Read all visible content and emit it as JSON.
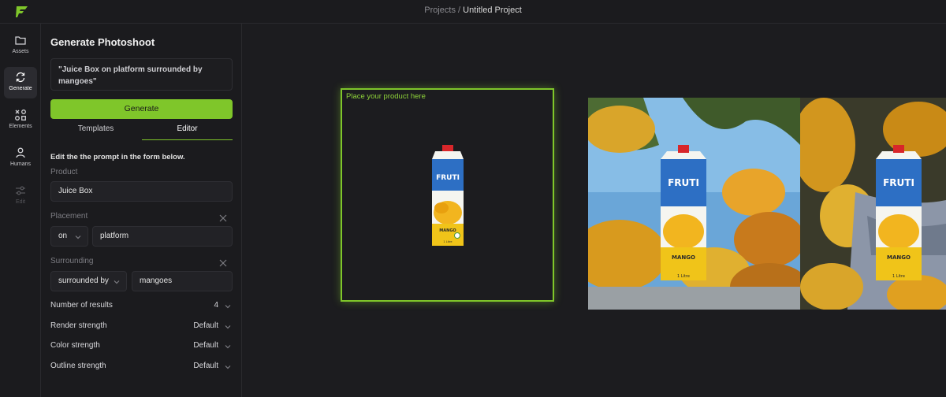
{
  "breadcrumb": {
    "parent": "Projects",
    "separator": " / ",
    "current": "Untitled Project"
  },
  "rail": {
    "items": [
      {
        "label": "Assets",
        "icon": "folder-icon"
      },
      {
        "label": "Generate",
        "icon": "refresh-icon"
      },
      {
        "label": "Elements",
        "icon": "shapes-icon"
      },
      {
        "label": "Humans",
        "icon": "person-icon"
      },
      {
        "label": "Edit",
        "icon": "sliders-icon"
      }
    ]
  },
  "panel": {
    "title": "Generate Photoshoot",
    "prompt": "\"Juice Box on platform surrounded by mangoes\"",
    "generate_label": "Generate",
    "tabs": [
      "Templates",
      "Editor"
    ],
    "instruction": "Edit the the prompt in the form below.",
    "product": {
      "label": "Product",
      "value": "Juice Box"
    },
    "placement": {
      "label": "Placement",
      "preposition": "on",
      "value": "platform"
    },
    "surrounding": {
      "label": "Surrounding",
      "preposition": "surrounded by",
      "value": "mangoes"
    },
    "options": [
      {
        "label": "Number of results",
        "value": "4"
      },
      {
        "label": "Render strength",
        "value": "Default"
      },
      {
        "label": "Color strength",
        "value": "Default"
      },
      {
        "label": "Outline strength",
        "value": "Default"
      }
    ]
  },
  "canvas": {
    "drop_label": "Place your product here",
    "product": {
      "brand": "FRUTI",
      "flavor": "MANGO",
      "size": "1 Litre"
    }
  },
  "colors": {
    "accent": "#7fc62a",
    "background": "#1c1c1f",
    "panel": "#1b1b1e"
  }
}
